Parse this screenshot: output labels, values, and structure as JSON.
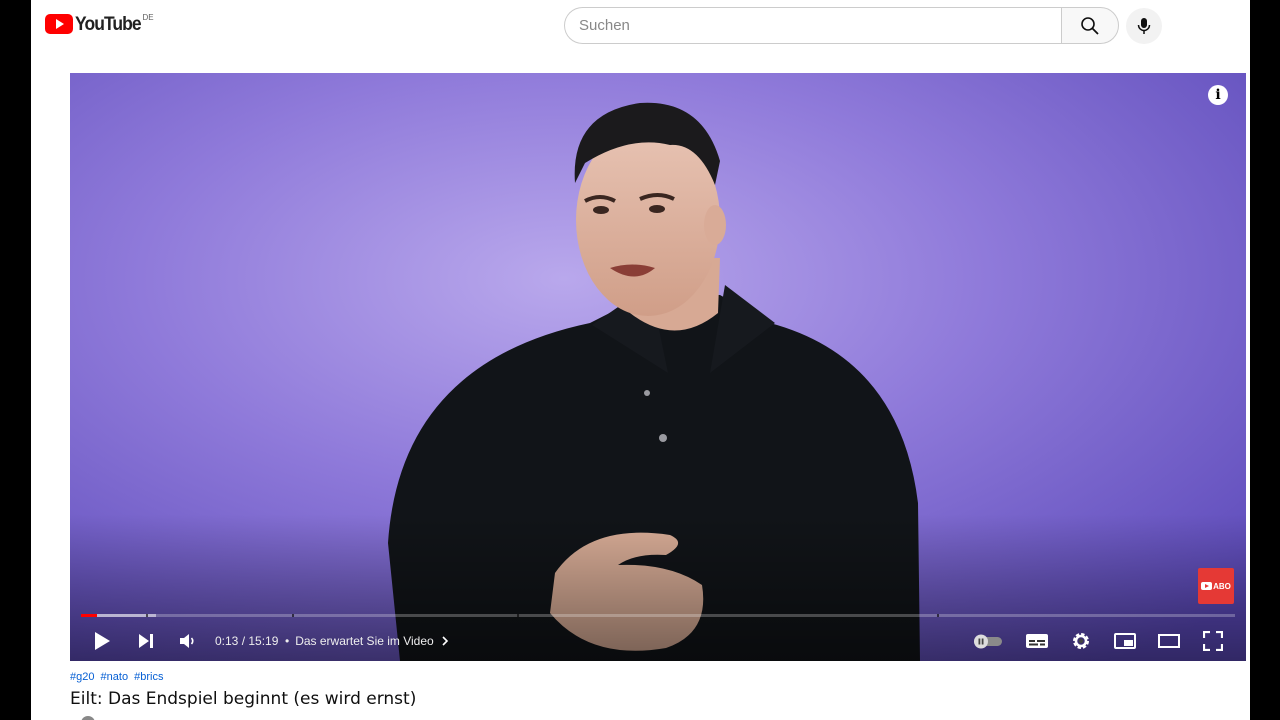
{
  "header": {
    "logo_text": "YouTube",
    "region": "DE",
    "search_placeholder": "Suchen"
  },
  "player": {
    "current_time": "0:13",
    "duration": "15:19",
    "time_display": "0:13 / 15:19",
    "chapter_label": "Das erwartet Sie im Video",
    "played_fraction": 0.014,
    "buffered_fraction": 0.065,
    "subscribe_badge": "ABO",
    "autoplay_on": false
  },
  "video": {
    "hashtags": [
      "#g20",
      "#nato",
      "#brics"
    ],
    "title": "Eilt: Das Endspiel beginnt (es wird ernst)"
  },
  "icons": [
    "youtube-logo-icon",
    "search-icon",
    "mic-icon",
    "info-icon",
    "play-icon",
    "next-icon",
    "volume-icon",
    "chevron-right-icon",
    "autoplay-toggle-icon",
    "subtitles-icon",
    "settings-icon",
    "miniplayer-icon",
    "theater-icon",
    "fullscreen-icon"
  ],
  "colors": {
    "brand_red": "#ff0000",
    "link_blue": "#065fd4",
    "backdrop": "#6c5cc6"
  }
}
